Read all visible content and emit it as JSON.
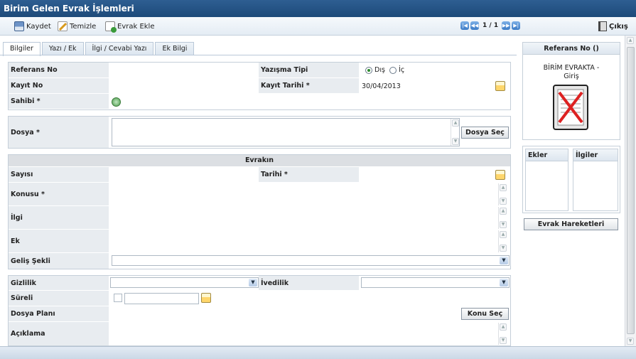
{
  "window": {
    "title": "Birim Gelen Evrak İşlemleri"
  },
  "toolbar": {
    "save_label": "Kaydet",
    "clear_label": "Temizle",
    "add_attachment_label": "Evrak Ekle",
    "pager_text": "1 / 1",
    "exit_label": "Çıkış"
  },
  "tabs": [
    {
      "label": "Bilgiler",
      "active": true
    },
    {
      "label": "Yazı / Ek",
      "active": false
    },
    {
      "label": "İlgi / Cevabi Yazı",
      "active": false
    },
    {
      "label": "Ek Bilgi",
      "active": false
    }
  ],
  "form": {
    "referans_no_label": "Referans No",
    "yazisma_tipi_label": "Yazışma Tipi",
    "yazisma_options": [
      {
        "label": "Dış",
        "selected": true
      },
      {
        "label": "İç",
        "selected": false
      }
    ],
    "kayit_no_label": "Kayıt No",
    "kayit_tarihi_label": "Kayıt Tarihi *",
    "kayit_tarihi_value": "30/04/2013",
    "sahibi_label": "Sahibi *",
    "dosya_label": "Dosya *",
    "dosya_sec_button": "Dosya Seç",
    "evrakin_section": "Evrakın",
    "sayisi_label": "Sayısı",
    "tarihi_label": "Tarihi *",
    "konusu_label": "Konusu *",
    "ilgi_label": "İlgi",
    "ek_label": "Ek",
    "gelis_sekli_label": "Geliş Şekli",
    "gizlilik_label": "Gizlilik",
    "ivedilik_label": "İvedilik",
    "sureli_label": "Süreli",
    "dosya_plani_label": "Dosya Planı",
    "konu_sec_button": "Konu Seç",
    "aciklama_label": "Açıklama"
  },
  "sidebar": {
    "referans_header": "Referans No ()",
    "status_text": "BİRİM EVRAKTA - Giriş",
    "ekler_label": "Ekler",
    "ilgiler_label": "İlgiler",
    "evrak_hareketleri_button": "Evrak Hareketleri"
  },
  "colors": {
    "title_bar": "#1d4a7a",
    "label_bg": "#e8ecf0",
    "accent": "#3c7bc6"
  }
}
